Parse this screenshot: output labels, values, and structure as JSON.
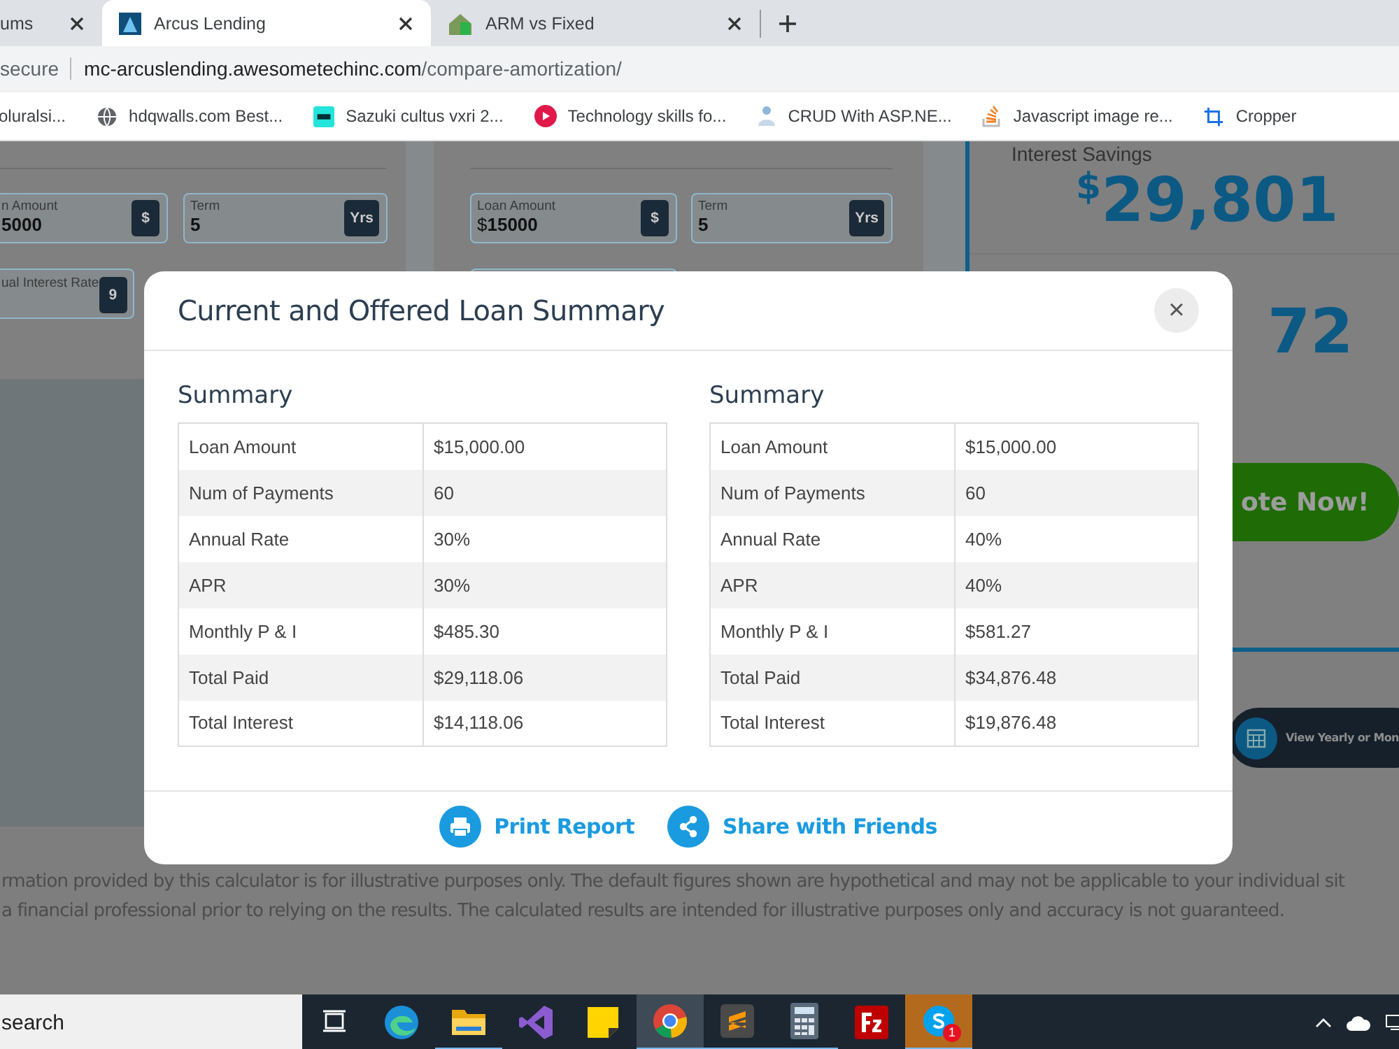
{
  "browser": {
    "tabs": [
      {
        "title": "ums",
        "selected": false
      },
      {
        "title": "Arcus Lending",
        "kind": "arcus",
        "selected": true
      },
      {
        "title": "ARM vs Fixed",
        "kind": "house",
        "selected": false
      }
    ],
    "address": {
      "security": "secure",
      "host": "mc-arcuslending.awesometechinc.com",
      "path": "/compare-amortization/"
    },
    "bookmarks": [
      {
        "label": "oluralsi...",
        "kind": "none"
      },
      {
        "label": "hdqwalls.com Best...",
        "kind": "globe"
      },
      {
        "label": "Sazuki cultus vxri 2...",
        "kind": "olx"
      },
      {
        "label": "Technology skills fo...",
        "kind": "play"
      },
      {
        "label": "CRUD With ASP.NE...",
        "kind": "person"
      },
      {
        "label": "Javascript image re...",
        "kind": "stack"
      },
      {
        "label": "Cropper",
        "kind": "crop"
      }
    ]
  },
  "page": {
    "cards": [
      {
        "fields": [
          {
            "label": "n Amount",
            "value": "5000",
            "addon": "$"
          },
          {
            "label": "Term",
            "value": "5",
            "addon": "Yrs"
          },
          {
            "label": "ual Interest Rate",
            "addon": "9"
          }
        ]
      },
      {
        "fields": [
          {
            "label": "Loan Amount",
            "value": "15000",
            "prefix": "$",
            "addon": "$"
          },
          {
            "label": "Term",
            "value": "5",
            "addon": "Yrs"
          }
        ]
      }
    ],
    "results": {
      "caption": "Interest Savings",
      "currency": "$",
      "amount": "29,801",
      "second_amount": "72",
      "quote_button": "ote Now!",
      "schedule_button": "View Yearly or Mon"
    },
    "disclaimer": [
      "rmation provided by this calculator is for illustrative purposes only. The default figures shown are hypothetical and may not be applicable to your individual sit",
      "a financial professional prior to relying on the results. The calculated results are intended for illustrative purposes only and accuracy is not guaranteed."
    ]
  },
  "modal": {
    "title": "Current and Offered Loan Summary",
    "close": "×",
    "summaries": [
      {
        "heading": "Summary",
        "rows": [
          {
            "label": "Loan Amount",
            "value": "$15,000.00"
          },
          {
            "label": "Num of Payments",
            "value": "60"
          },
          {
            "label": "Annual Rate",
            "value": "30%"
          },
          {
            "label": "APR",
            "value": "30%"
          },
          {
            "label": "Monthly P & I",
            "value": "$485.30"
          },
          {
            "label": "Total Paid",
            "value": "$29,118.06"
          },
          {
            "label": "Total Interest",
            "value": "$14,118.06"
          }
        ]
      },
      {
        "heading": "Summary",
        "rows": [
          {
            "label": "Loan Amount",
            "value": "$15,000.00"
          },
          {
            "label": "Num of Payments",
            "value": "60"
          },
          {
            "label": "Annual Rate",
            "value": "40%"
          },
          {
            "label": "APR",
            "value": "40%"
          },
          {
            "label": "Monthly P & I",
            "value": "$581.27"
          },
          {
            "label": "Total Paid",
            "value": "$34,876.48"
          },
          {
            "label": "Total Interest",
            "value": "$19,876.48"
          }
        ]
      }
    ],
    "actions": [
      {
        "kind": "print",
        "label": "Print Report"
      },
      {
        "kind": "share",
        "label": "Share with Friends"
      }
    ]
  },
  "taskbar": {
    "search": "search",
    "apps": [
      {
        "kind": "taskview",
        "running": false,
        "selected": false,
        "attention": false
      },
      {
        "kind": "edge",
        "running": false,
        "selected": false,
        "attention": false
      },
      {
        "kind": "explorer",
        "running": true,
        "selected": false,
        "attention": false
      },
      {
        "kind": "studio",
        "running": false,
        "selected": false,
        "attention": false
      },
      {
        "kind": "notes",
        "running": false,
        "selected": false,
        "attention": false
      },
      {
        "kind": "chrome",
        "running": true,
        "selected": true,
        "attention": false
      },
      {
        "kind": "sublime",
        "running": true,
        "selected": false,
        "attention": false
      },
      {
        "kind": "calculator",
        "running": true,
        "selected": false,
        "attention": false
      },
      {
        "kind": "filezilla",
        "running": false,
        "selected": false,
        "attention": false
      },
      {
        "kind": "skype",
        "running": true,
        "selected": false,
        "attention": true,
        "badge": "1"
      }
    ]
  }
}
